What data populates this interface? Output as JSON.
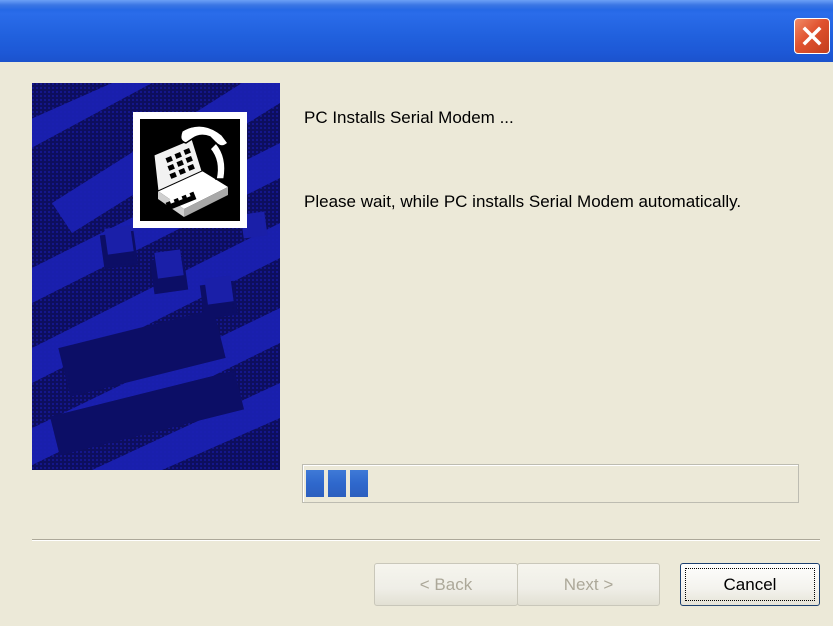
{
  "dialog": {
    "heading": "PC Installs Serial Modem ...",
    "message": "Please wait, while PC installs Serial Modem automatically."
  },
  "progress": {
    "fraction": 0.14,
    "blocks_filled": 3
  },
  "buttons": {
    "back_label": "< Back",
    "next_label": "Next >",
    "cancel_label": "Cancel"
  },
  "icons": {
    "close": "close-icon",
    "telephone": "telephone-icon"
  },
  "colors": {
    "titlebar": "#2060dd",
    "close_button": "#e0522f",
    "panel_background": "#0b0c58",
    "progress_fill": "#2f68cc",
    "dialog_background": "#ece9d8"
  }
}
